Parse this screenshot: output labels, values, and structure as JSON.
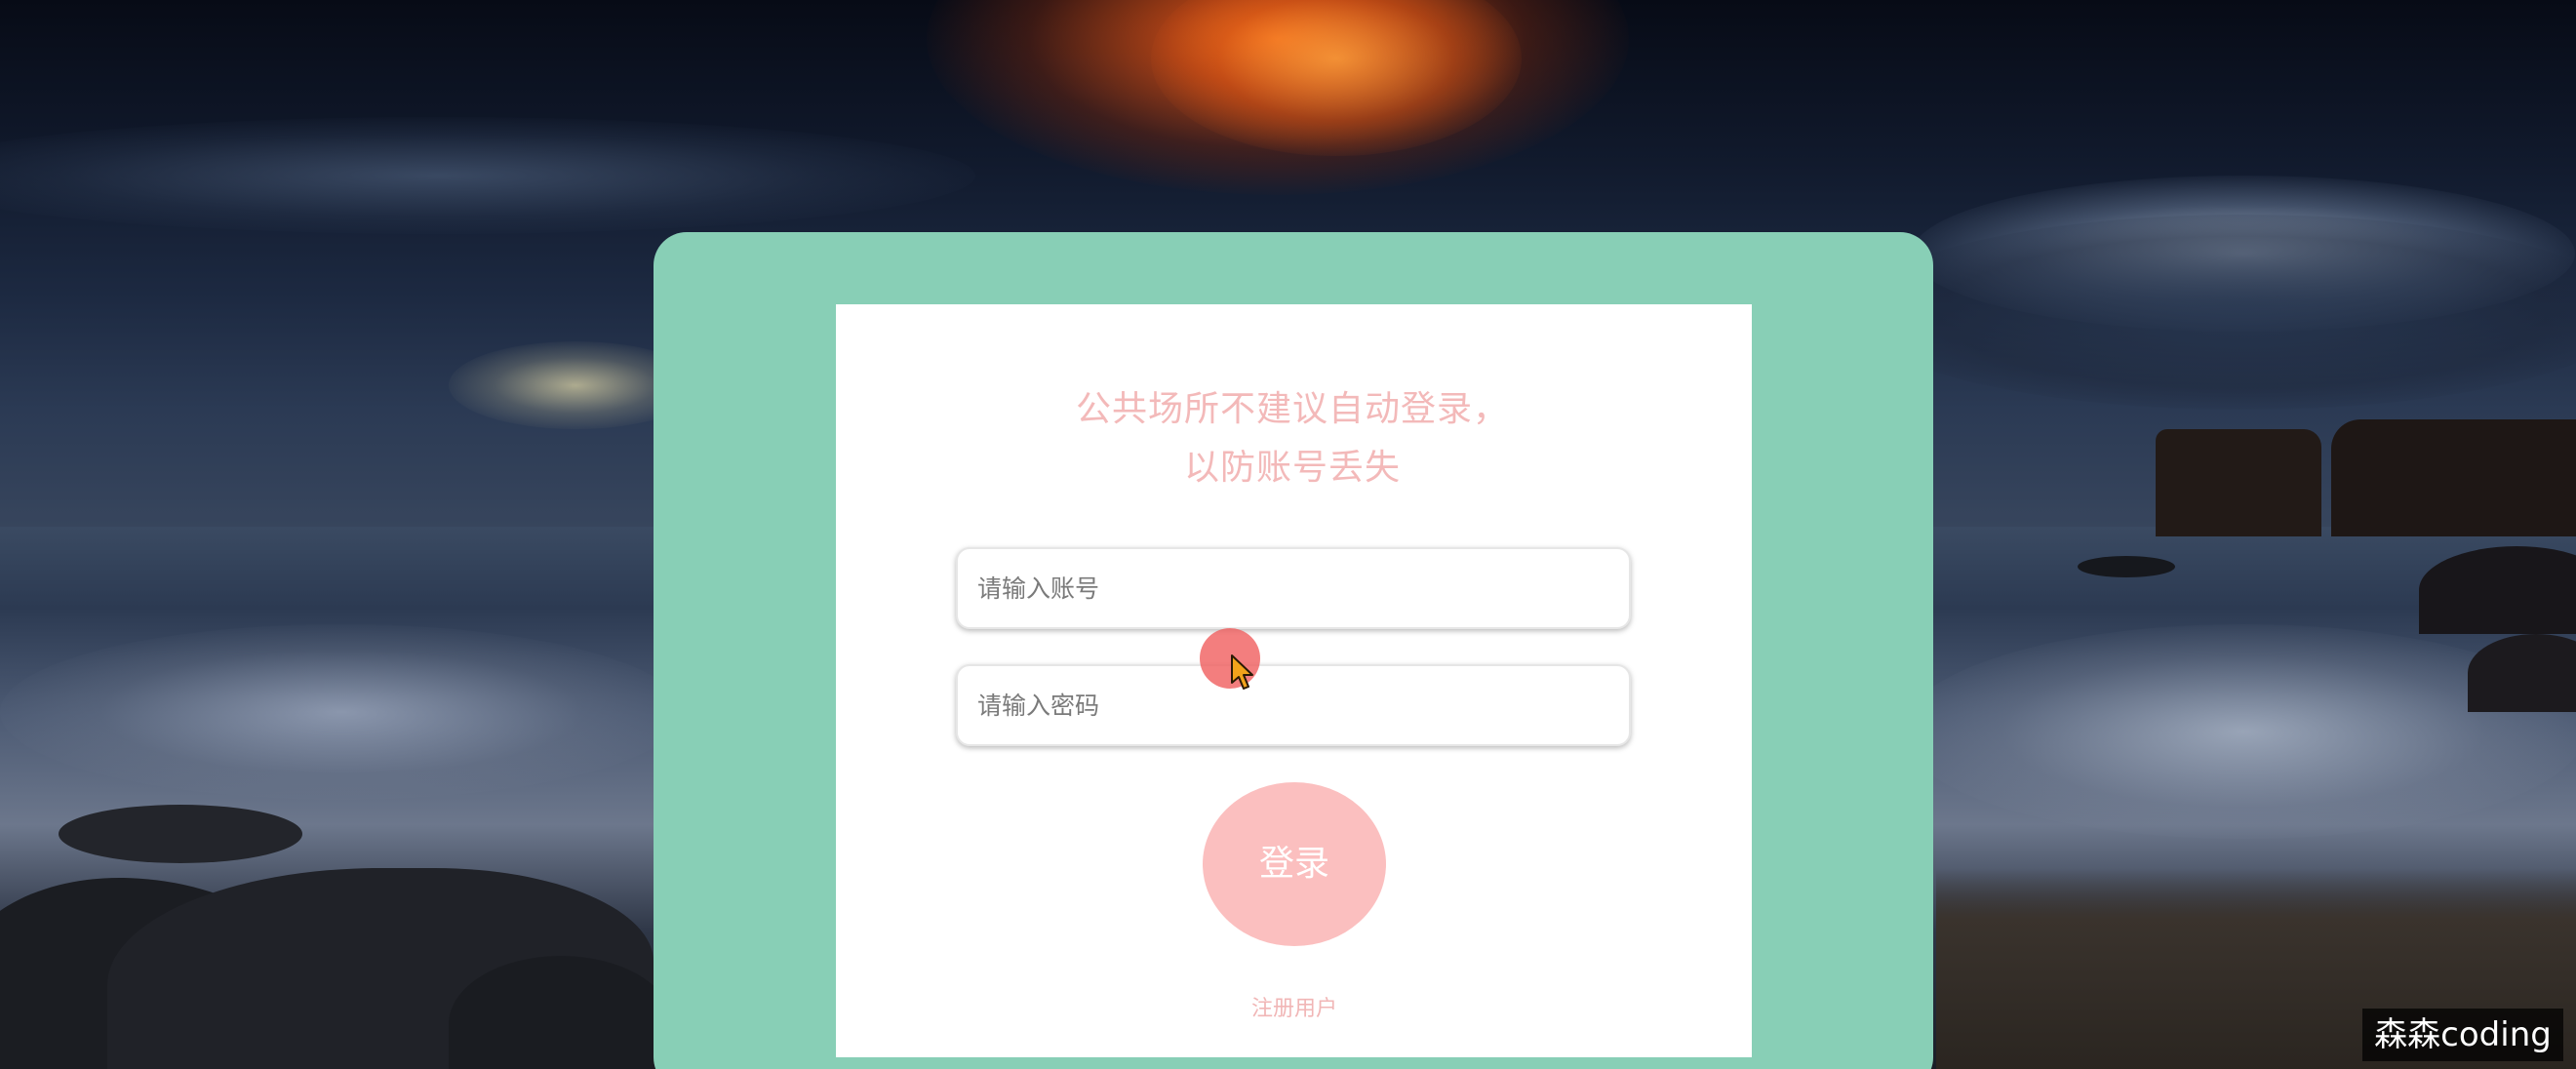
{
  "login": {
    "notice": "公共场所不建议自动登录，以防账号丢失",
    "username_placeholder": "请输入账号",
    "password_placeholder": "请输入密码",
    "login_button": "登录",
    "register_link": "注册用户"
  },
  "watermark": "森森coding",
  "colors": {
    "panel_outer": "#88cfb6",
    "panel_inner": "#ffffff",
    "accent_pink": "#fbbfbf",
    "notice_text": "#f3b9b9"
  },
  "icons": {
    "cursor": "cursor-arrow-icon"
  }
}
